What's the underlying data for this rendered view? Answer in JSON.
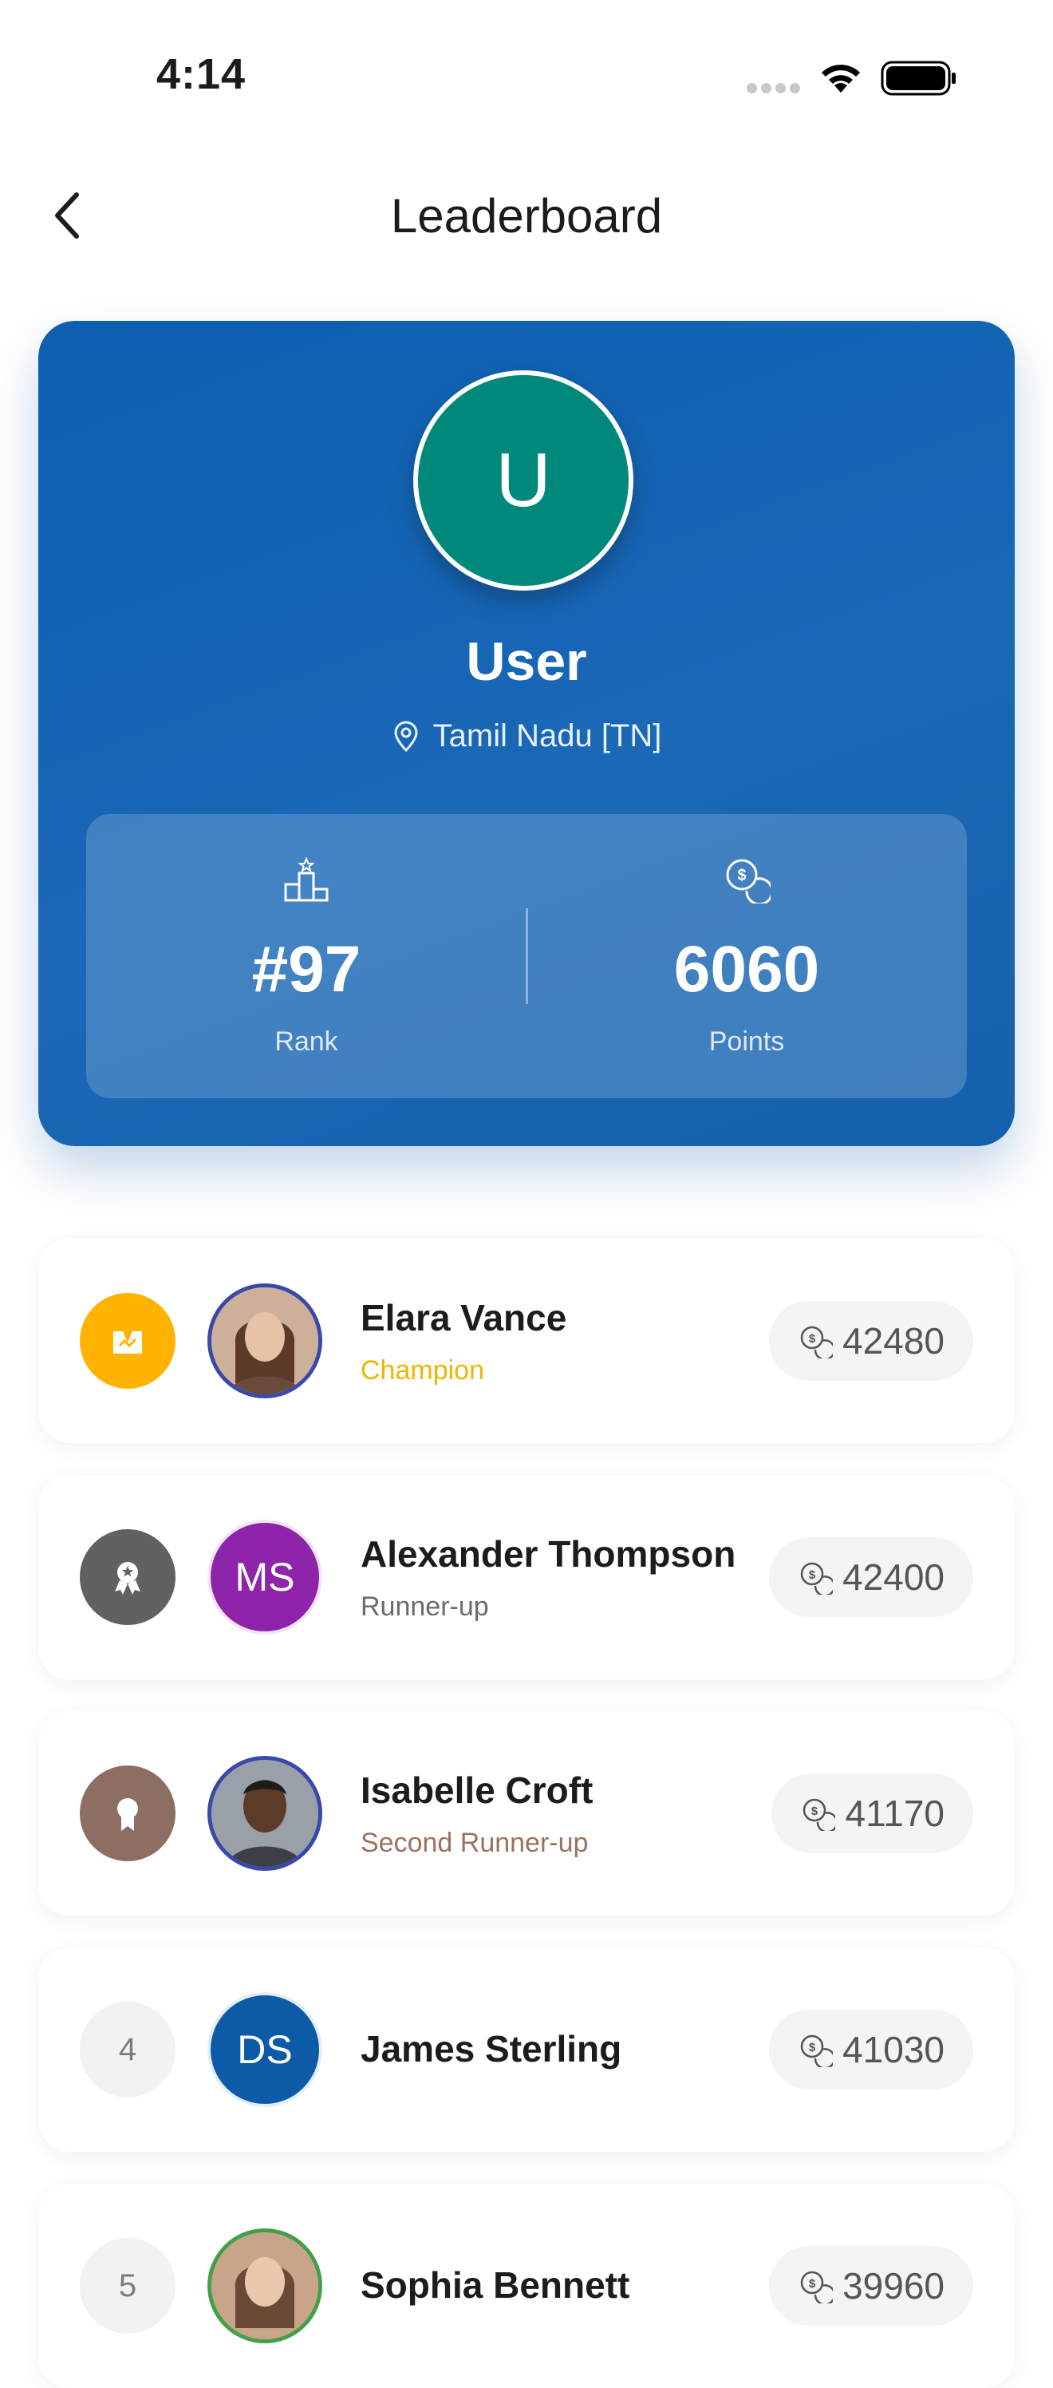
{
  "status_bar": {
    "time": "4:14"
  },
  "header": {
    "title": "Leaderboard"
  },
  "profile": {
    "initial": "U",
    "avatar_color": "#00897b",
    "name": "User",
    "location": "Tamil Nadu [TN]",
    "rank": "#97",
    "rank_label": "Rank",
    "points": "6060",
    "points_label": "Points"
  },
  "leaderboard": [
    {
      "position": "",
      "medal": "champion-medal",
      "medal_color": "#ffb300",
      "name": "Elara Vance",
      "title": "Champion",
      "title_color": "#f0b400",
      "points": "42480",
      "avatar": "photo",
      "avatar_ring": "#3949ab"
    },
    {
      "position": "",
      "medal": "runner-up-medal",
      "medal_color": "#616161",
      "name": "Alexander Thompson",
      "title": "Runner-up",
      "title_color": "#6b6b70",
      "points": "42400",
      "avatar": "MS",
      "avatar_color": "#8e24aa"
    },
    {
      "position": "",
      "medal": "second-runner-up-medal",
      "medal_color": "#8d6e63",
      "name": "Isabelle Croft",
      "title": "Second Runner-up",
      "title_color": "#9a7360",
      "points": "41170",
      "avatar": "photo",
      "avatar_ring": "#3949ab"
    },
    {
      "position": "4",
      "name": "James Sterling",
      "title": "",
      "points": "41030",
      "avatar": "DS",
      "avatar_color": "#0d5aa7"
    },
    {
      "position": "5",
      "name": "Sophia Bennett",
      "title": "",
      "points": "39960",
      "avatar": "photo",
      "avatar_ring": "#43a047"
    }
  ]
}
